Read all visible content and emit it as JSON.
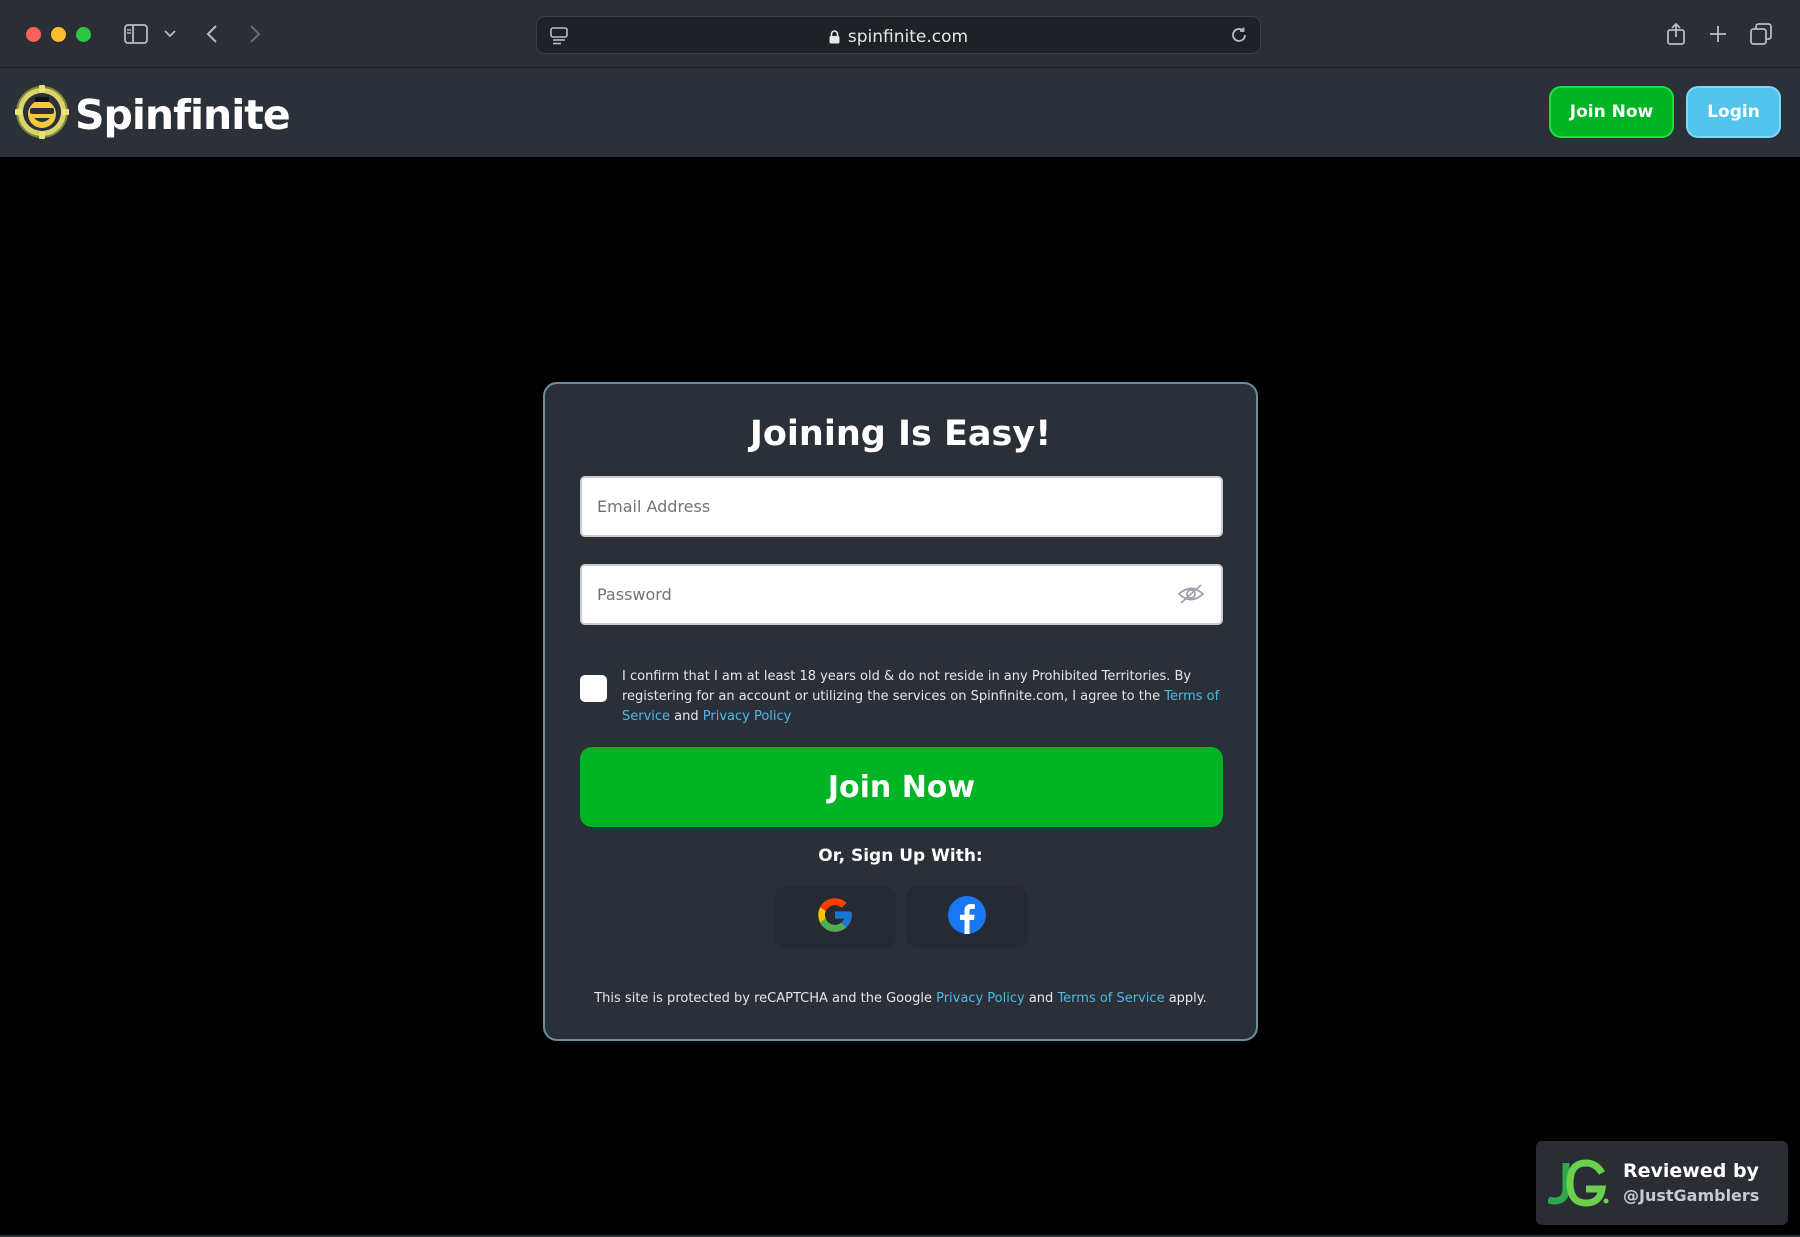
{
  "browser": {
    "url": "spinfinite.com"
  },
  "header": {
    "logo_text": "Spinfinite",
    "join_label": "Join Now",
    "login_label": "Login"
  },
  "form": {
    "title": "Joining Is Easy!",
    "email_placeholder": "Email Address",
    "password_placeholder": "Password",
    "consent": {
      "text_before": "I confirm that I am at least 18 years old & do not reside in any Prohibited Territories. By registering for an account or utilizing the services on Spinfinite.com, I agree to the ",
      "terms_link": "Terms of Service",
      "and": " and ",
      "privacy_link": "Privacy Policy",
      "checked": false
    },
    "submit_label": "Join Now",
    "social_heading": "Or, Sign Up With:",
    "social_buttons": [
      "google-icon",
      "facebook-icon"
    ],
    "recaptcha": {
      "text_before": "This site is protected by reCAPTCHA and the Google ",
      "privacy_link": "Privacy Policy",
      "and": " and ",
      "terms_link": "Terms of Service",
      "text_after": " apply."
    }
  },
  "badge": {
    "line1": "Reviewed by",
    "line2": "@JustGamblers"
  },
  "colors": {
    "primary_green": "#00b424",
    "login_blue": "#53c4ee",
    "link_blue": "#4fb9e6",
    "card_bg": "#2b2f37"
  }
}
